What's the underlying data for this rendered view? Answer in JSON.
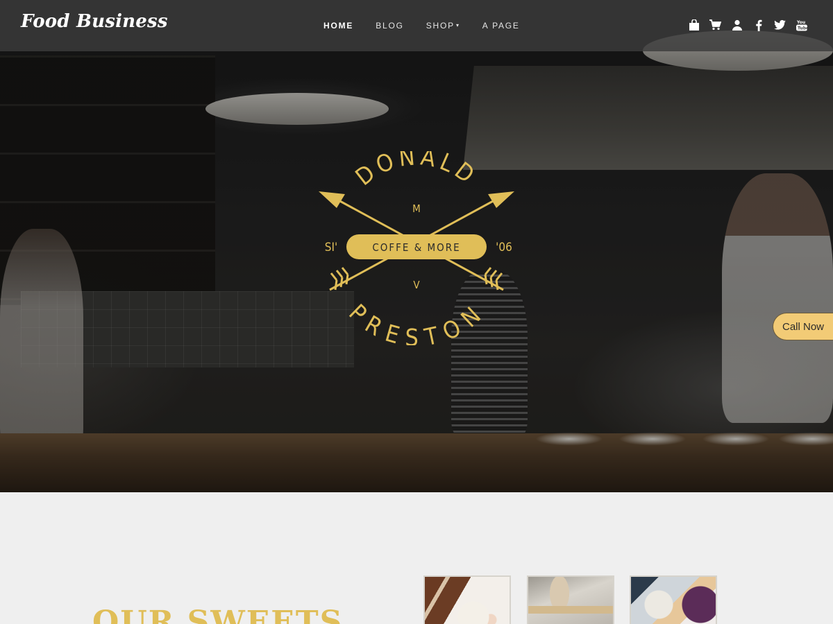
{
  "brand": {
    "name": "Food Business"
  },
  "nav": {
    "items": [
      {
        "label": "HOME",
        "active": true
      },
      {
        "label": "BLOG"
      },
      {
        "label": "SHOP",
        "has_dropdown": true
      },
      {
        "label": "A PAGE"
      }
    ]
  },
  "header_icons": [
    "bag-icon",
    "cart-icon",
    "user-icon",
    "facebook-icon",
    "twitter-icon",
    "youtube-icon"
  ],
  "hero": {
    "emblem": {
      "top_text": "DONALD",
      "bottom_text": "PRESTON",
      "center_text": "COFFE & MORE",
      "left_text": "SI'",
      "right_text": "'06",
      "upper_initial": "M",
      "lower_initial": "V",
      "color": "#e0be58"
    }
  },
  "call_button": {
    "label": "Call Now",
    "color": "#f2cb76"
  },
  "section": {
    "title": "OUR SWEETS"
  },
  "colors": {
    "accent": "#e0be58",
    "header_bg": "#3c3c3c",
    "page_bg": "#efefef"
  }
}
